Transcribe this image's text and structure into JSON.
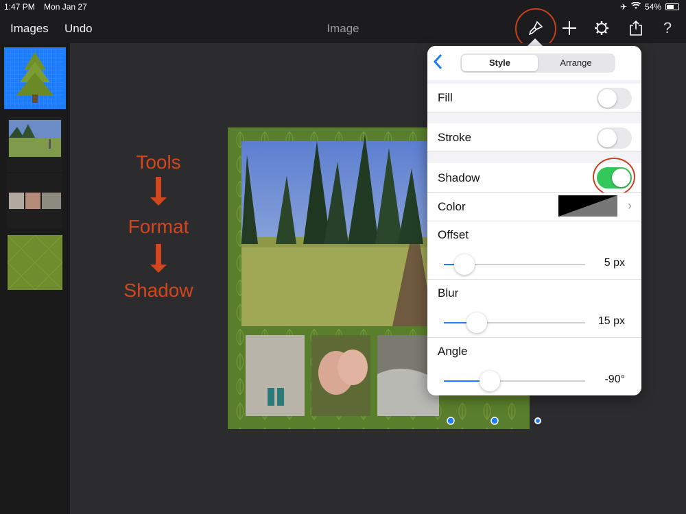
{
  "status_bar": {
    "time": "1:47 PM",
    "date": "Mon Jan 27",
    "battery": "54%",
    "icons": [
      "airplane-icon",
      "wifi-icon",
      "battery-icon"
    ]
  },
  "toolbar": {
    "images_label": "Images",
    "undo_label": "Undo",
    "title": "Image",
    "icons": [
      "paintbrush-icon",
      "plus-icon",
      "gear-icon",
      "share-icon",
      "help-icon"
    ]
  },
  "annotation": {
    "step1": "Tools",
    "step2": "Format",
    "step3": "Shadow"
  },
  "popover": {
    "tabs": [
      {
        "label": "Style",
        "active": true
      },
      {
        "label": "Arrange",
        "active": false
      }
    ],
    "fill": {
      "label": "Fill",
      "on": false
    },
    "stroke": {
      "label": "Stroke",
      "on": false
    },
    "shadow": {
      "label": "Shadow",
      "on": true
    },
    "color": {
      "label": "Color"
    },
    "offset": {
      "label": "Offset",
      "value": "5 px",
      "fraction": 0.1
    },
    "blur": {
      "label": "Blur",
      "value": "15 px",
      "fraction": 0.19
    },
    "angle": {
      "label": "Angle",
      "value": "-90°",
      "fraction": 0.28
    }
  },
  "colors": {
    "accent": "#1b7cff",
    "toggle_on": "#34c759",
    "annotation": "#d4461d",
    "page_bg": "#5a7f2c"
  }
}
